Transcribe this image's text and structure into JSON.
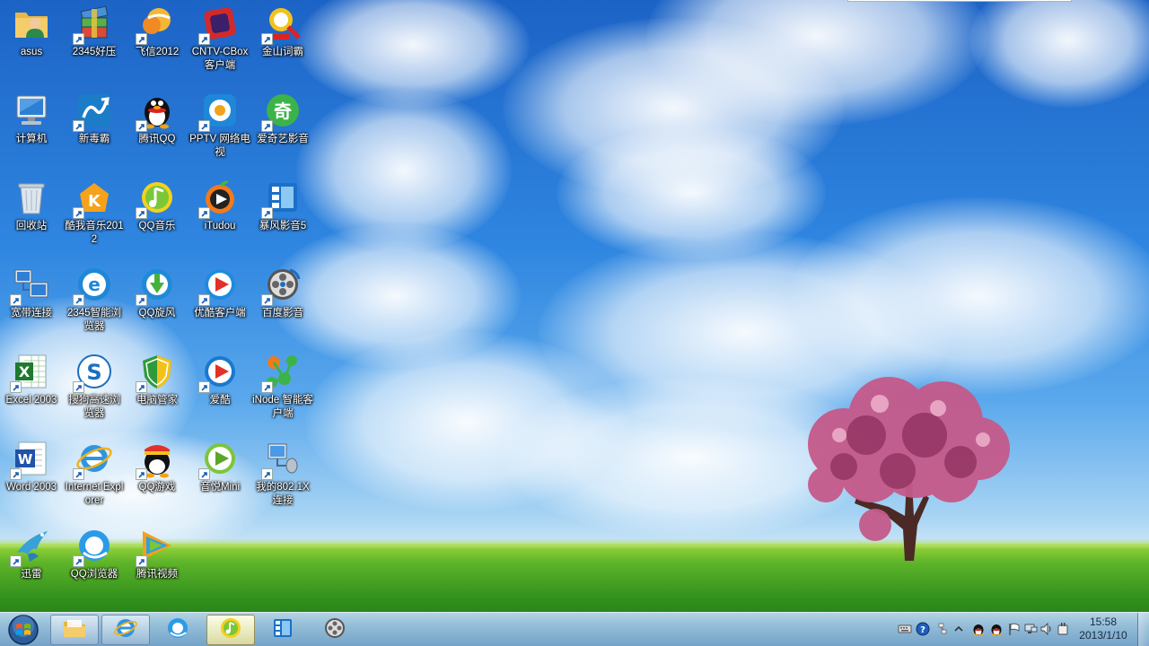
{
  "desktop": {
    "icons": [
      {
        "label": "asus",
        "icon": "user-folder-icon"
      },
      {
        "label": "计算机",
        "icon": "computer-icon"
      },
      {
        "label": "回收站",
        "icon": "recycle-bin-icon"
      },
      {
        "label": "宽带连接",
        "icon": "broadband-connection-icon"
      },
      {
        "label": "Excel 2003",
        "icon": "excel-icon"
      },
      {
        "label": "Word 2003",
        "icon": "word-icon"
      },
      {
        "label": "迅雷",
        "icon": "xunlei-icon"
      },
      {
        "label": "2345好压",
        "icon": "haozip-icon"
      },
      {
        "label": "新毒霸",
        "icon": "duba-antivirus-icon"
      },
      {
        "label": "酷我音乐2012",
        "icon": "kuwo-music-icon"
      },
      {
        "label": "2345智能浏览器",
        "icon": "2345-browser-icon"
      },
      {
        "label": "搜狗高速浏览器",
        "icon": "sogou-browser-icon"
      },
      {
        "label": "Internet Explorer",
        "icon": "internet-explorer-icon"
      },
      {
        "label": "QQ浏览器",
        "icon": "qq-browser-icon"
      },
      {
        "label": "飞信2012",
        "icon": "fetion-icon"
      },
      {
        "label": "腾讯QQ",
        "icon": "qq-penguin-icon"
      },
      {
        "label": "QQ音乐",
        "icon": "qq-music-icon"
      },
      {
        "label": "QQ旋风",
        "icon": "qq-whirlwind-icon"
      },
      {
        "label": "电脑管家",
        "icon": "pc-manager-shield-icon"
      },
      {
        "label": "QQ游戏",
        "icon": "qq-games-icon"
      },
      {
        "label": "腾讯视频",
        "icon": "tencent-video-icon"
      },
      {
        "label": "CNTV-CBox客户端",
        "icon": "cbox-icon"
      },
      {
        "label": "PPTV 网络电视",
        "icon": "pptv-icon"
      },
      {
        "label": "iTudou",
        "icon": "itudou-icon"
      },
      {
        "label": "优酷客户端",
        "icon": "youku-icon"
      },
      {
        "label": "爱酷",
        "icon": "aiku-icon"
      },
      {
        "label": "音悦Mini",
        "icon": "yinyue-mini-icon"
      },
      {
        "label": "金山词霸",
        "icon": "kingsoft-powerword-icon"
      },
      {
        "label": "爱奇艺影音",
        "icon": "iqiyi-icon"
      },
      {
        "label": "暴风影音5",
        "icon": "baofeng-icon"
      },
      {
        "label": "百度影音",
        "icon": "baidu-player-icon"
      },
      {
        "label": "iNode 智能客户端",
        "icon": "inode-icon"
      },
      {
        "label": "我的802.1X连接",
        "icon": "8021x-connection-icon"
      }
    ]
  },
  "taskbar": {
    "start_icon": "windows-start-orb-icon",
    "pinned": [
      {
        "icon": "file-explorer-icon",
        "state": "open"
      },
      {
        "icon": "internet-explorer-icon",
        "state": "open"
      },
      {
        "icon": "qq-browser-icon",
        "state": "normal"
      },
      {
        "icon": "qq-music-icon",
        "state": "active"
      },
      {
        "icon": "baofeng-icon",
        "state": "normal"
      },
      {
        "icon": "baidu-player-icon",
        "state": "normal"
      }
    ],
    "tray": {
      "icons": [
        "keyboard-icon",
        "help-icon",
        "network-share-icon",
        "show-hidden-icons-chevron",
        "qq-tray-icon",
        "qq-tray-icon",
        "action-center-flag-icon",
        "network-icon",
        "volume-icon",
        "power-icon"
      ],
      "time": "15:58",
      "date": "2013/1/10"
    }
  },
  "colors": {
    "sky_top": "#1c63c6",
    "grass": "#2f8f1c",
    "taskbar": "#9ec3e6"
  }
}
